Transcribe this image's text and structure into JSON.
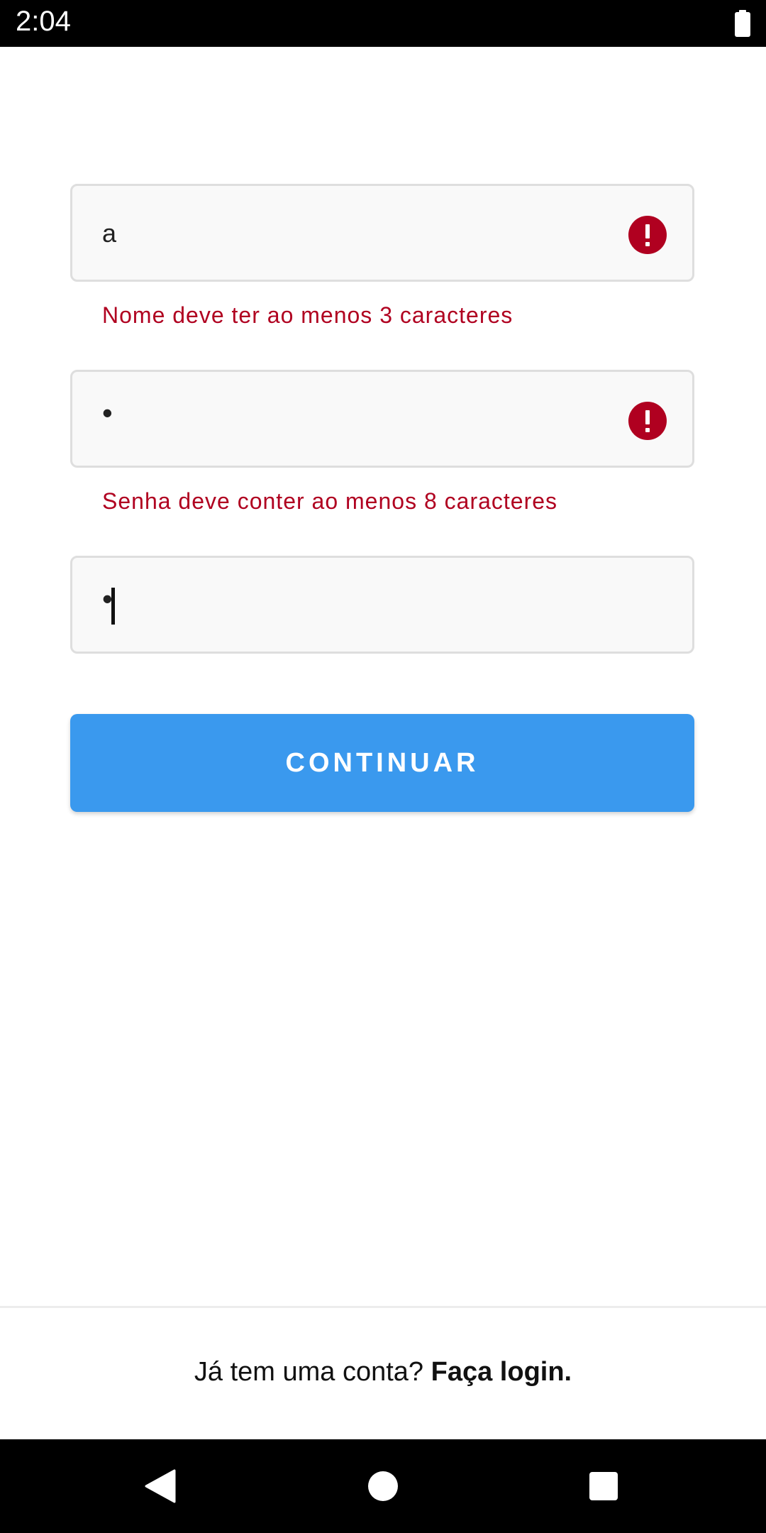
{
  "status_bar": {
    "time": "2:04",
    "battery_icon": "battery-full-icon"
  },
  "form": {
    "name_field": {
      "value": "a",
      "error_icon": "error-icon",
      "error_message": "Nome deve ter ao menos 3 caracteres"
    },
    "password_field": {
      "value": "•",
      "error_icon": "error-icon",
      "error_message": "Senha deve conter ao menos 8 caracteres"
    },
    "confirm_password_field": {
      "value": "•"
    },
    "continue_button_label": "CONTINUAR"
  },
  "footer": {
    "prompt": "Já tem uma conta?",
    "login_link": "Faça login."
  },
  "nav_bar": {
    "back_icon": "back-triangle-icon",
    "home_icon": "home-circle-icon",
    "recents_icon": "recents-square-icon"
  },
  "colors": {
    "error": "#b00020",
    "primary_button": "#3a99ee",
    "field_background": "#f9f9f9",
    "field_border": "#dedede"
  }
}
